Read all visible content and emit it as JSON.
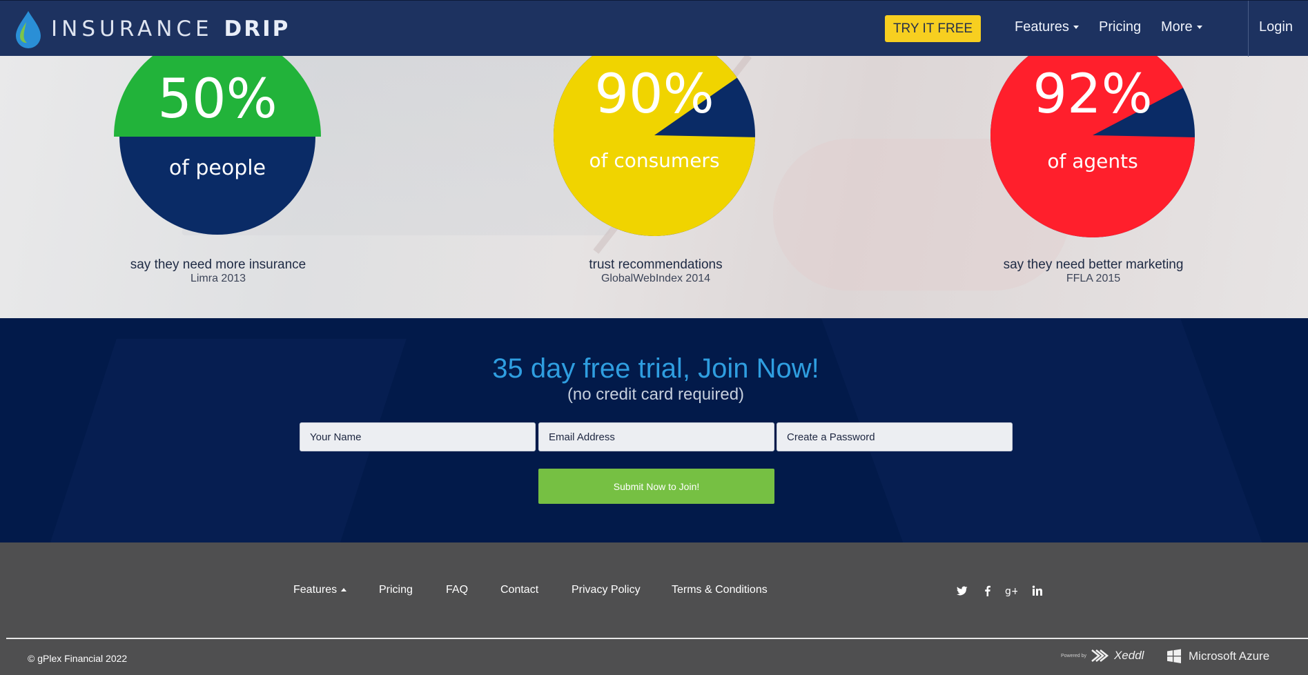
{
  "brand": {
    "name_light": "INSURANCE",
    "name_bold": "DRIP"
  },
  "nav": {
    "try_label": "TRY IT FREE",
    "features": "Features",
    "pricing": "Pricing",
    "more": "More",
    "login": "Login"
  },
  "stats": [
    {
      "percent": "50%",
      "value": 50,
      "label": "of people",
      "caption": "say they need more insurance",
      "source": "Limra 2013",
      "color": "#22b33a"
    },
    {
      "percent": "90%",
      "value": 90,
      "label": "of consumers",
      "caption": "trust recommendations",
      "source": "GlobalWebIndex 2014",
      "color": "#f0d400"
    },
    {
      "percent": "92%",
      "value": 92,
      "label": "of agents",
      "caption": "say they need better marketing",
      "source": "FFLA 2015",
      "color": "#ff1f2c"
    }
  ],
  "join": {
    "title": "35 day free trial, Join Now!",
    "subtitle": "(no credit card required)",
    "name_placeholder": "Your Name",
    "email_placeholder": "Email Address",
    "password_placeholder": "Create a Password",
    "submit": "Submit Now to Join!"
  },
  "footer": {
    "links": {
      "features": "Features",
      "pricing": "Pricing",
      "faq": "FAQ",
      "contact": "Contact",
      "privacy": "Privacy Policy",
      "terms": "Terms & Conditions"
    },
    "social": [
      "twitter-icon",
      "facebook-icon",
      "google-plus-icon",
      "linkedin-icon"
    ],
    "copyright": "© gPlex Financial 2022",
    "powered_by_label": "Powered by",
    "xeddl": "Xeddl",
    "azure": "Microsoft Azure"
  },
  "colors": {
    "nav": "#1d3260",
    "accent": "#f7cf20",
    "join_bg": "#021a4a",
    "title": "#2f9ee0",
    "submit": "#76c043",
    "footer": "#4f4f50",
    "pie_base": "#0a2b66"
  }
}
